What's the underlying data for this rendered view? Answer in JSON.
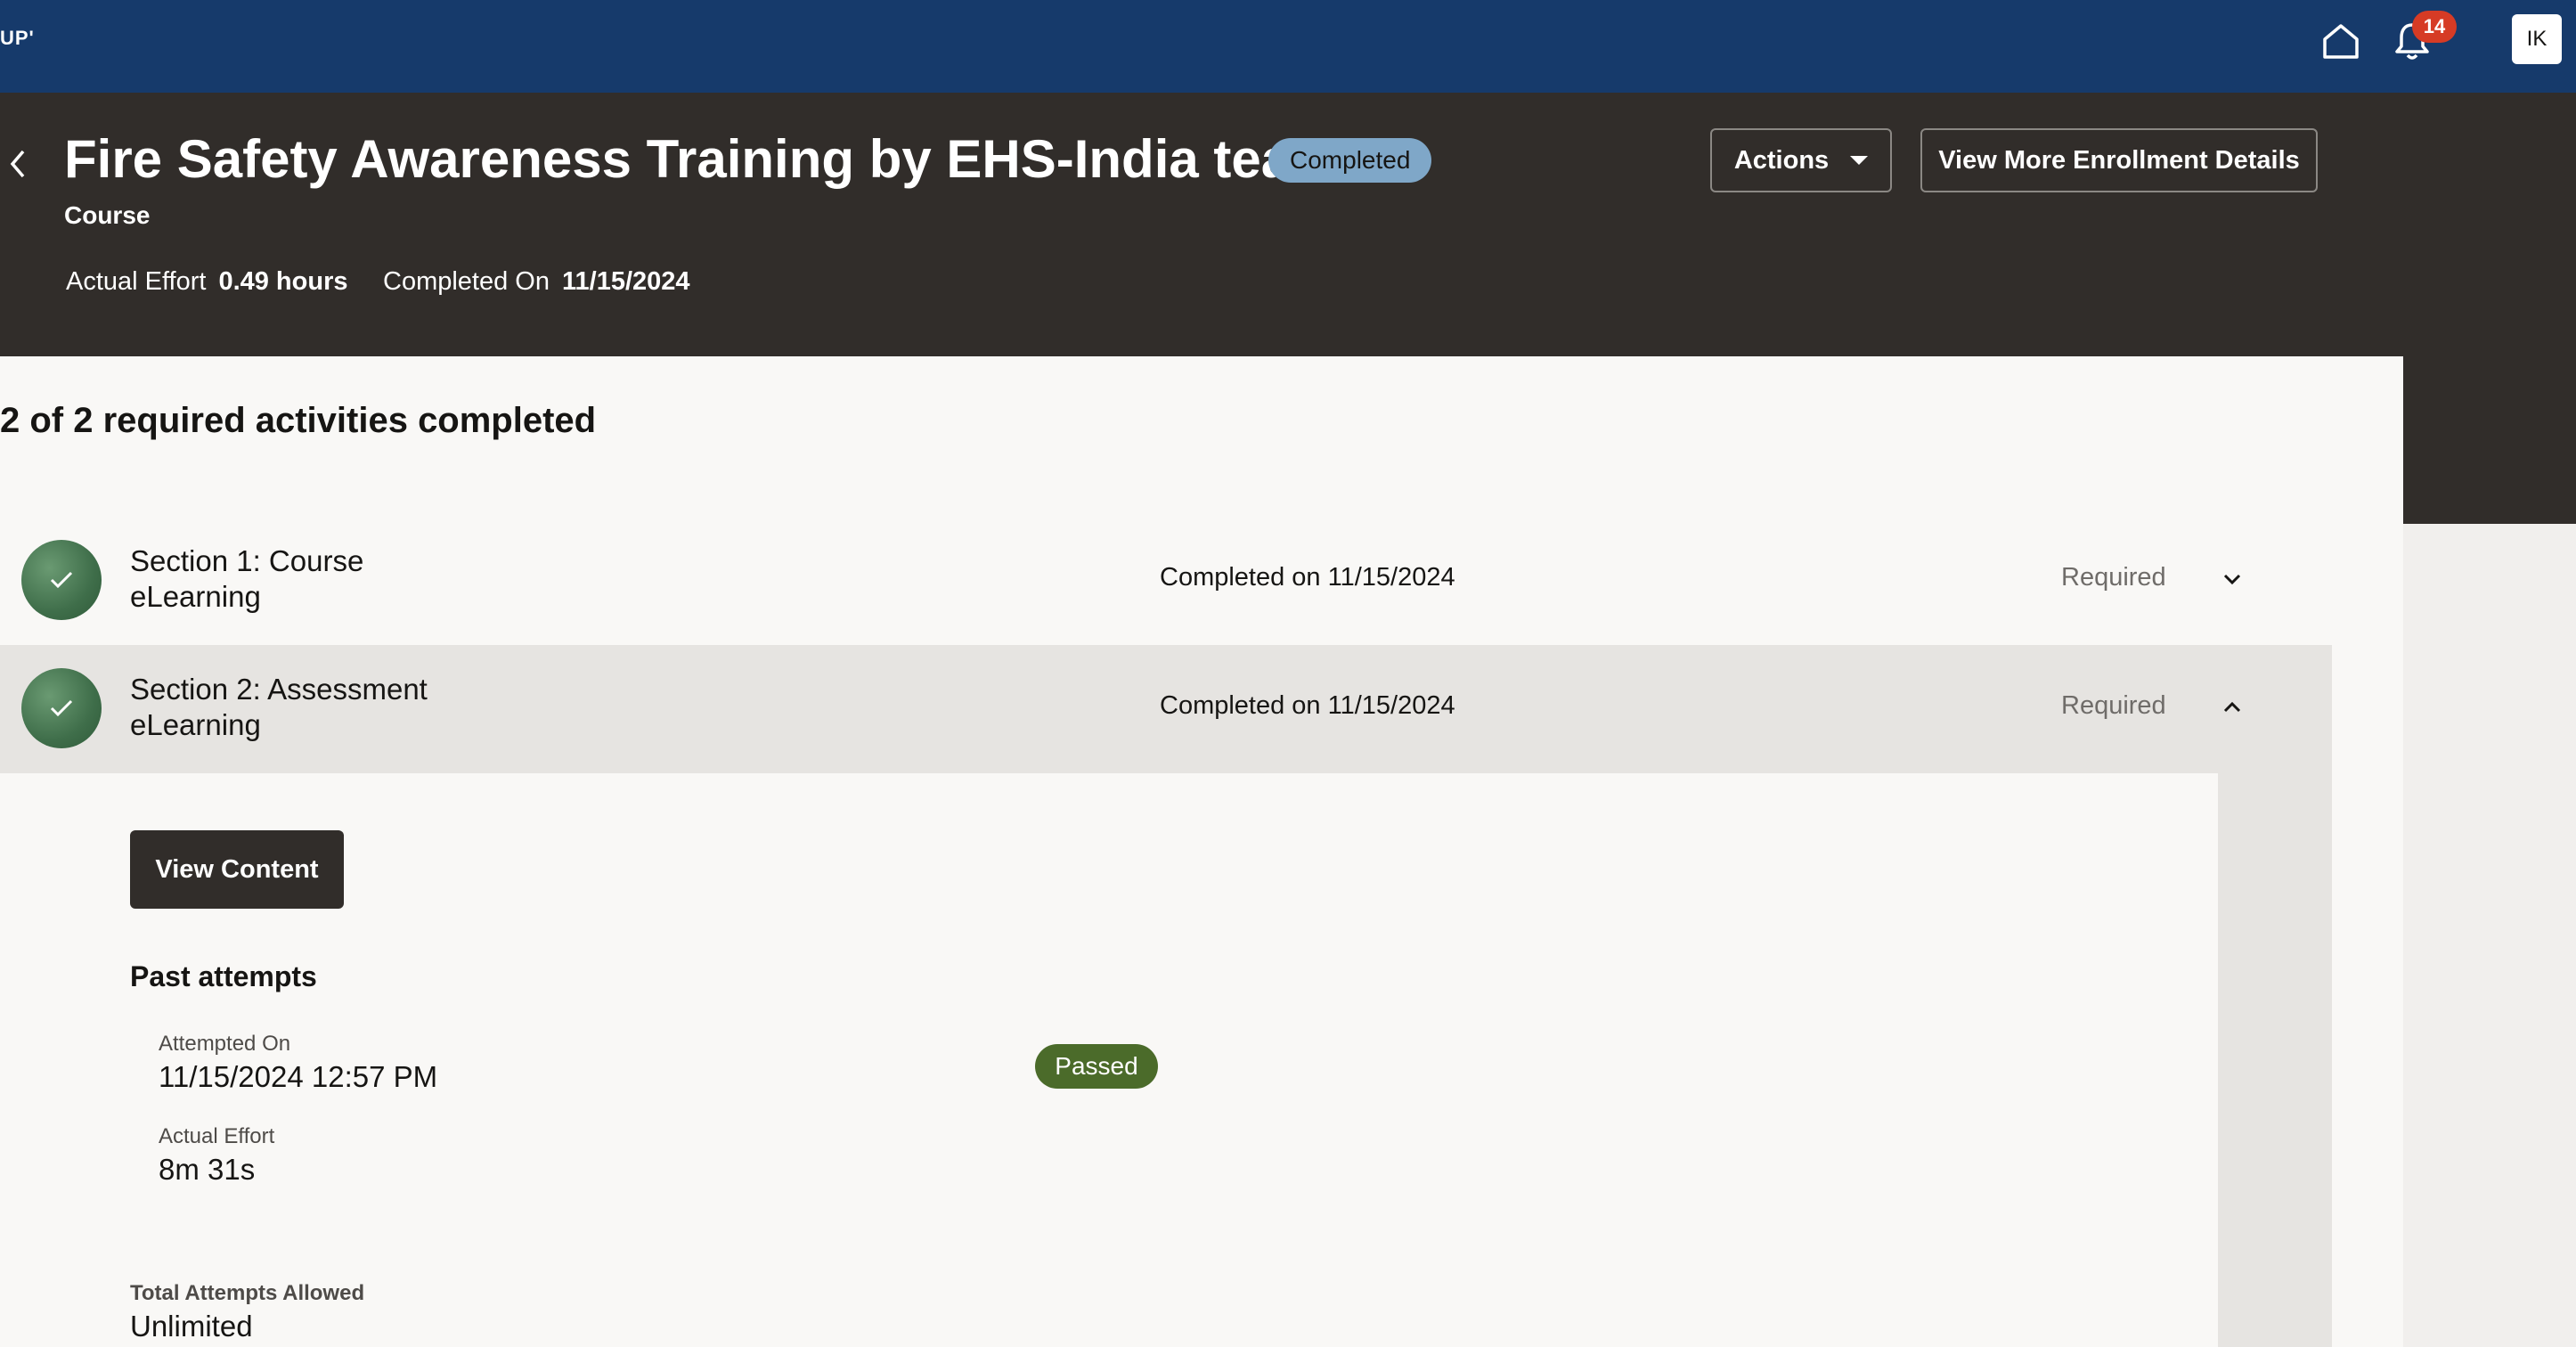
{
  "topbar": {
    "brand": "UP'",
    "notification_count": "14",
    "avatar_initials": "IK",
    "icons": [
      "home-icon",
      "bell-icon"
    ]
  },
  "header": {
    "title": "Fire Safety Awareness Training by EHS-India team",
    "status": "Completed",
    "subtitle": "Course",
    "actual_effort_label": "Actual Effort",
    "actual_effort_value": "0.49 hours",
    "completed_on_label": "Completed On",
    "completed_on_value": "11/15/2024",
    "actions_label": "Actions",
    "more_details_label": "View More Enrollment Details"
  },
  "progress": {
    "heading": "2 of 2 required activities completed"
  },
  "activities": [
    {
      "title": "Section 1: Course",
      "type": "eLearning",
      "completed": "Completed on 11/15/2024",
      "requirement": "Required",
      "expanded": false
    },
    {
      "title": "Section 2: Assessment",
      "type": "eLearning",
      "completed": "Completed on 11/15/2024",
      "requirement": "Required",
      "expanded": true
    }
  ],
  "details": {
    "view_content_label": "View Content",
    "past_attempts_heading": "Past attempts",
    "attempted_on_label": "Attempted On",
    "attempted_on_value": "11/15/2024 12:57 PM",
    "attempt_status": "Passed",
    "actual_effort_label": "Actual Effort",
    "actual_effort_value": "8m 31s",
    "total_attempts_label": "Total Attempts Allowed",
    "total_attempts_value": "Unlimited"
  },
  "colors": {
    "topbar": "#163a6b",
    "header": "#312d2a",
    "status_pill": "#7fa7c8",
    "passed_pill": "#4b6b2a",
    "notification_badge": "#d63b25"
  }
}
